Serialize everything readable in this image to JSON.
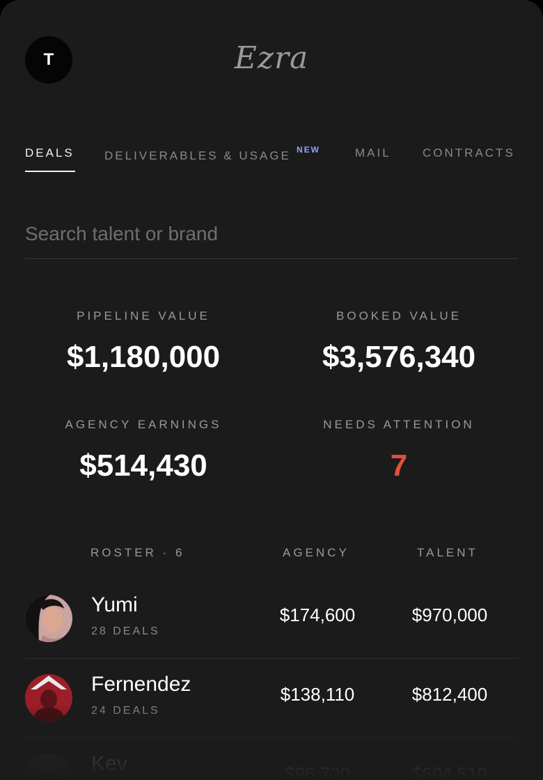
{
  "header": {
    "avatar_initial": "T",
    "brand": "Ezra"
  },
  "tabs": [
    {
      "label": "DEALS",
      "active": true
    },
    {
      "label": "DELIVERABLES & USAGE",
      "badge": "NEW"
    },
    {
      "label": "MAIL"
    },
    {
      "label": "CONTRACTS"
    }
  ],
  "search": {
    "placeholder": "Search talent or brand",
    "value": ""
  },
  "stats": {
    "pipeline": {
      "label": "PIPELINE VALUE",
      "value": "$1,180,000"
    },
    "booked": {
      "label": "BOOKED VALUE",
      "value": "$3,576,340"
    },
    "earnings": {
      "label": "AGENCY EARNINGS",
      "value": "$514,430"
    },
    "attention": {
      "label": "NEEDS ATTENTION",
      "value": "7"
    }
  },
  "roster": {
    "headers": {
      "roster": "ROSTER · 6",
      "agency": "AGENCY",
      "talent": "TALENT"
    },
    "rows": [
      {
        "name": "Yumi",
        "deals": "28 DEALS",
        "agency": "$174,600",
        "talent": "$970,000"
      },
      {
        "name": "Fernendez",
        "deals": "24 DEALS",
        "agency": "$138,110",
        "talent": "$812,400"
      },
      {
        "name": "Kev",
        "deals": "",
        "agency": "$96,720",
        "talent": "$604,510"
      }
    ]
  },
  "colors": {
    "background": "#1b1b1b",
    "alert": "#e4503b",
    "new_badge": "#8ea4ff"
  }
}
